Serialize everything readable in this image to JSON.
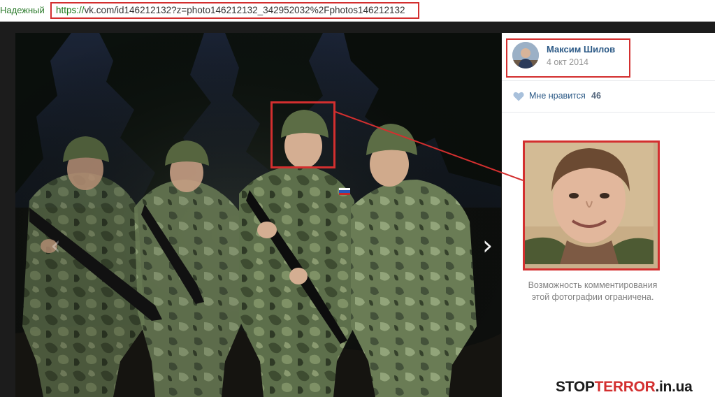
{
  "browser": {
    "secure_label": "Надежный",
    "url_scheme": "https://",
    "url_rest": "vk.com/id146212132?z=photo146212132_342952032%2Fphotos146212132"
  },
  "viewer": {
    "prev_arrow": "‹",
    "next_arrow": "›"
  },
  "post": {
    "author_name": "Максим Шилов",
    "date": "4 окт 2014",
    "like_label": "Мне нравится",
    "like_count": "46",
    "comment_notice": "Возможность комментирования этой фотографии ограничена."
  },
  "watermark": {
    "part1": "STOP",
    "part2": "TERROR",
    "part3": ".in.ua"
  },
  "colors": {
    "highlight": "#d32f2f",
    "link": "#2a5885",
    "secure_green": "#2a7a2a"
  },
  "icons": [
    "heart-icon",
    "avatar",
    "chevron-left-icon",
    "chevron-right-icon"
  ]
}
